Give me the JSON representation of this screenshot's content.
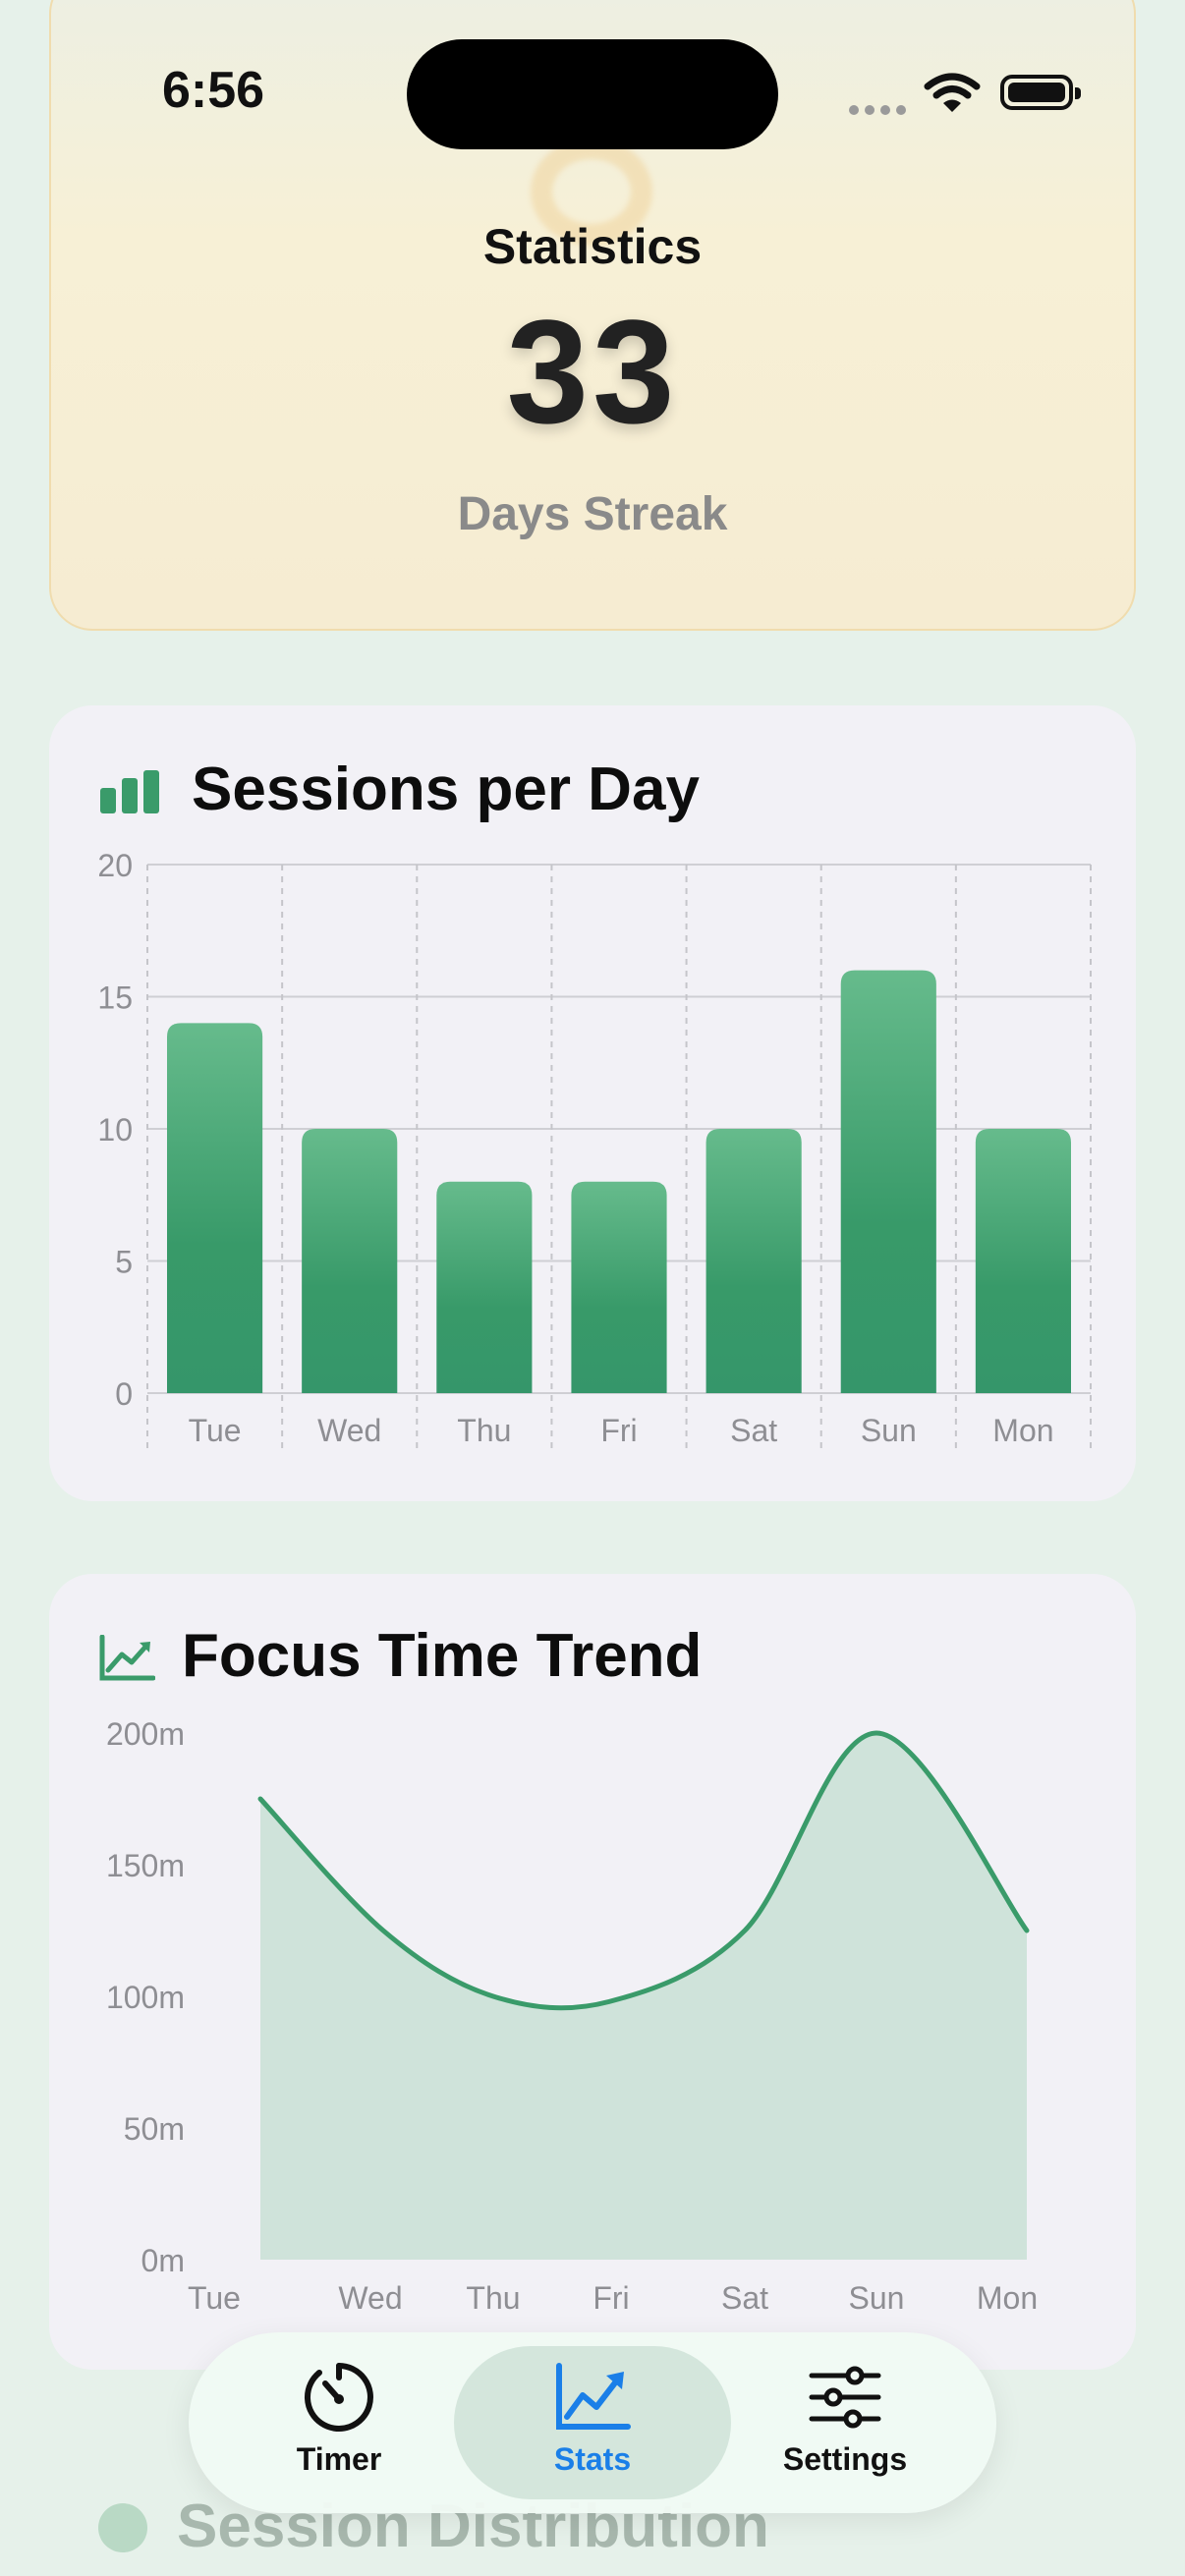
{
  "status_bar": {
    "time": "6:56"
  },
  "streak": {
    "title": "Statistics",
    "value": "33",
    "label": "Days Streak"
  },
  "sessions_card": {
    "title": "Sessions per Day",
    "icon": "bar-chart-icon"
  },
  "trend_card": {
    "title": "Focus Time Trend",
    "icon": "line-chart-icon"
  },
  "next_section": {
    "title": "Session Distribution",
    "icon": "pie-chart-icon"
  },
  "tab_bar": {
    "items": [
      {
        "label": "Timer",
        "icon": "timer-icon",
        "active": false
      },
      {
        "label": "Stats",
        "icon": "stats-icon",
        "active": true
      },
      {
        "label": "Settings",
        "icon": "sliders-icon",
        "active": false
      }
    ]
  },
  "colors": {
    "accent_green": "#3a9b6a",
    "active_tab": "#1a7fe8"
  },
  "chart_data": [
    {
      "type": "bar",
      "title": "Sessions per Day",
      "categories": [
        "Tue",
        "Wed",
        "Thu",
        "Fri",
        "Sat",
        "Sun",
        "Mon"
      ],
      "values": [
        14,
        10,
        8,
        8,
        10,
        16,
        10
      ],
      "ylim": [
        0,
        20
      ],
      "yticks": [
        "0",
        "5",
        "10",
        "15",
        "20"
      ],
      "grid": true
    },
    {
      "type": "area",
      "title": "Focus Time Trend",
      "categories": [
        "Tue",
        "Wed",
        "Thu",
        "Fri",
        "Sat",
        "Sun",
        "Mon"
      ],
      "values": [
        175,
        125,
        100,
        98,
        125,
        200,
        125
      ],
      "ylim": [
        0,
        200
      ],
      "yticks": [
        "0m",
        "50m",
        "100m",
        "150m",
        "200m"
      ],
      "grid": false
    }
  ]
}
